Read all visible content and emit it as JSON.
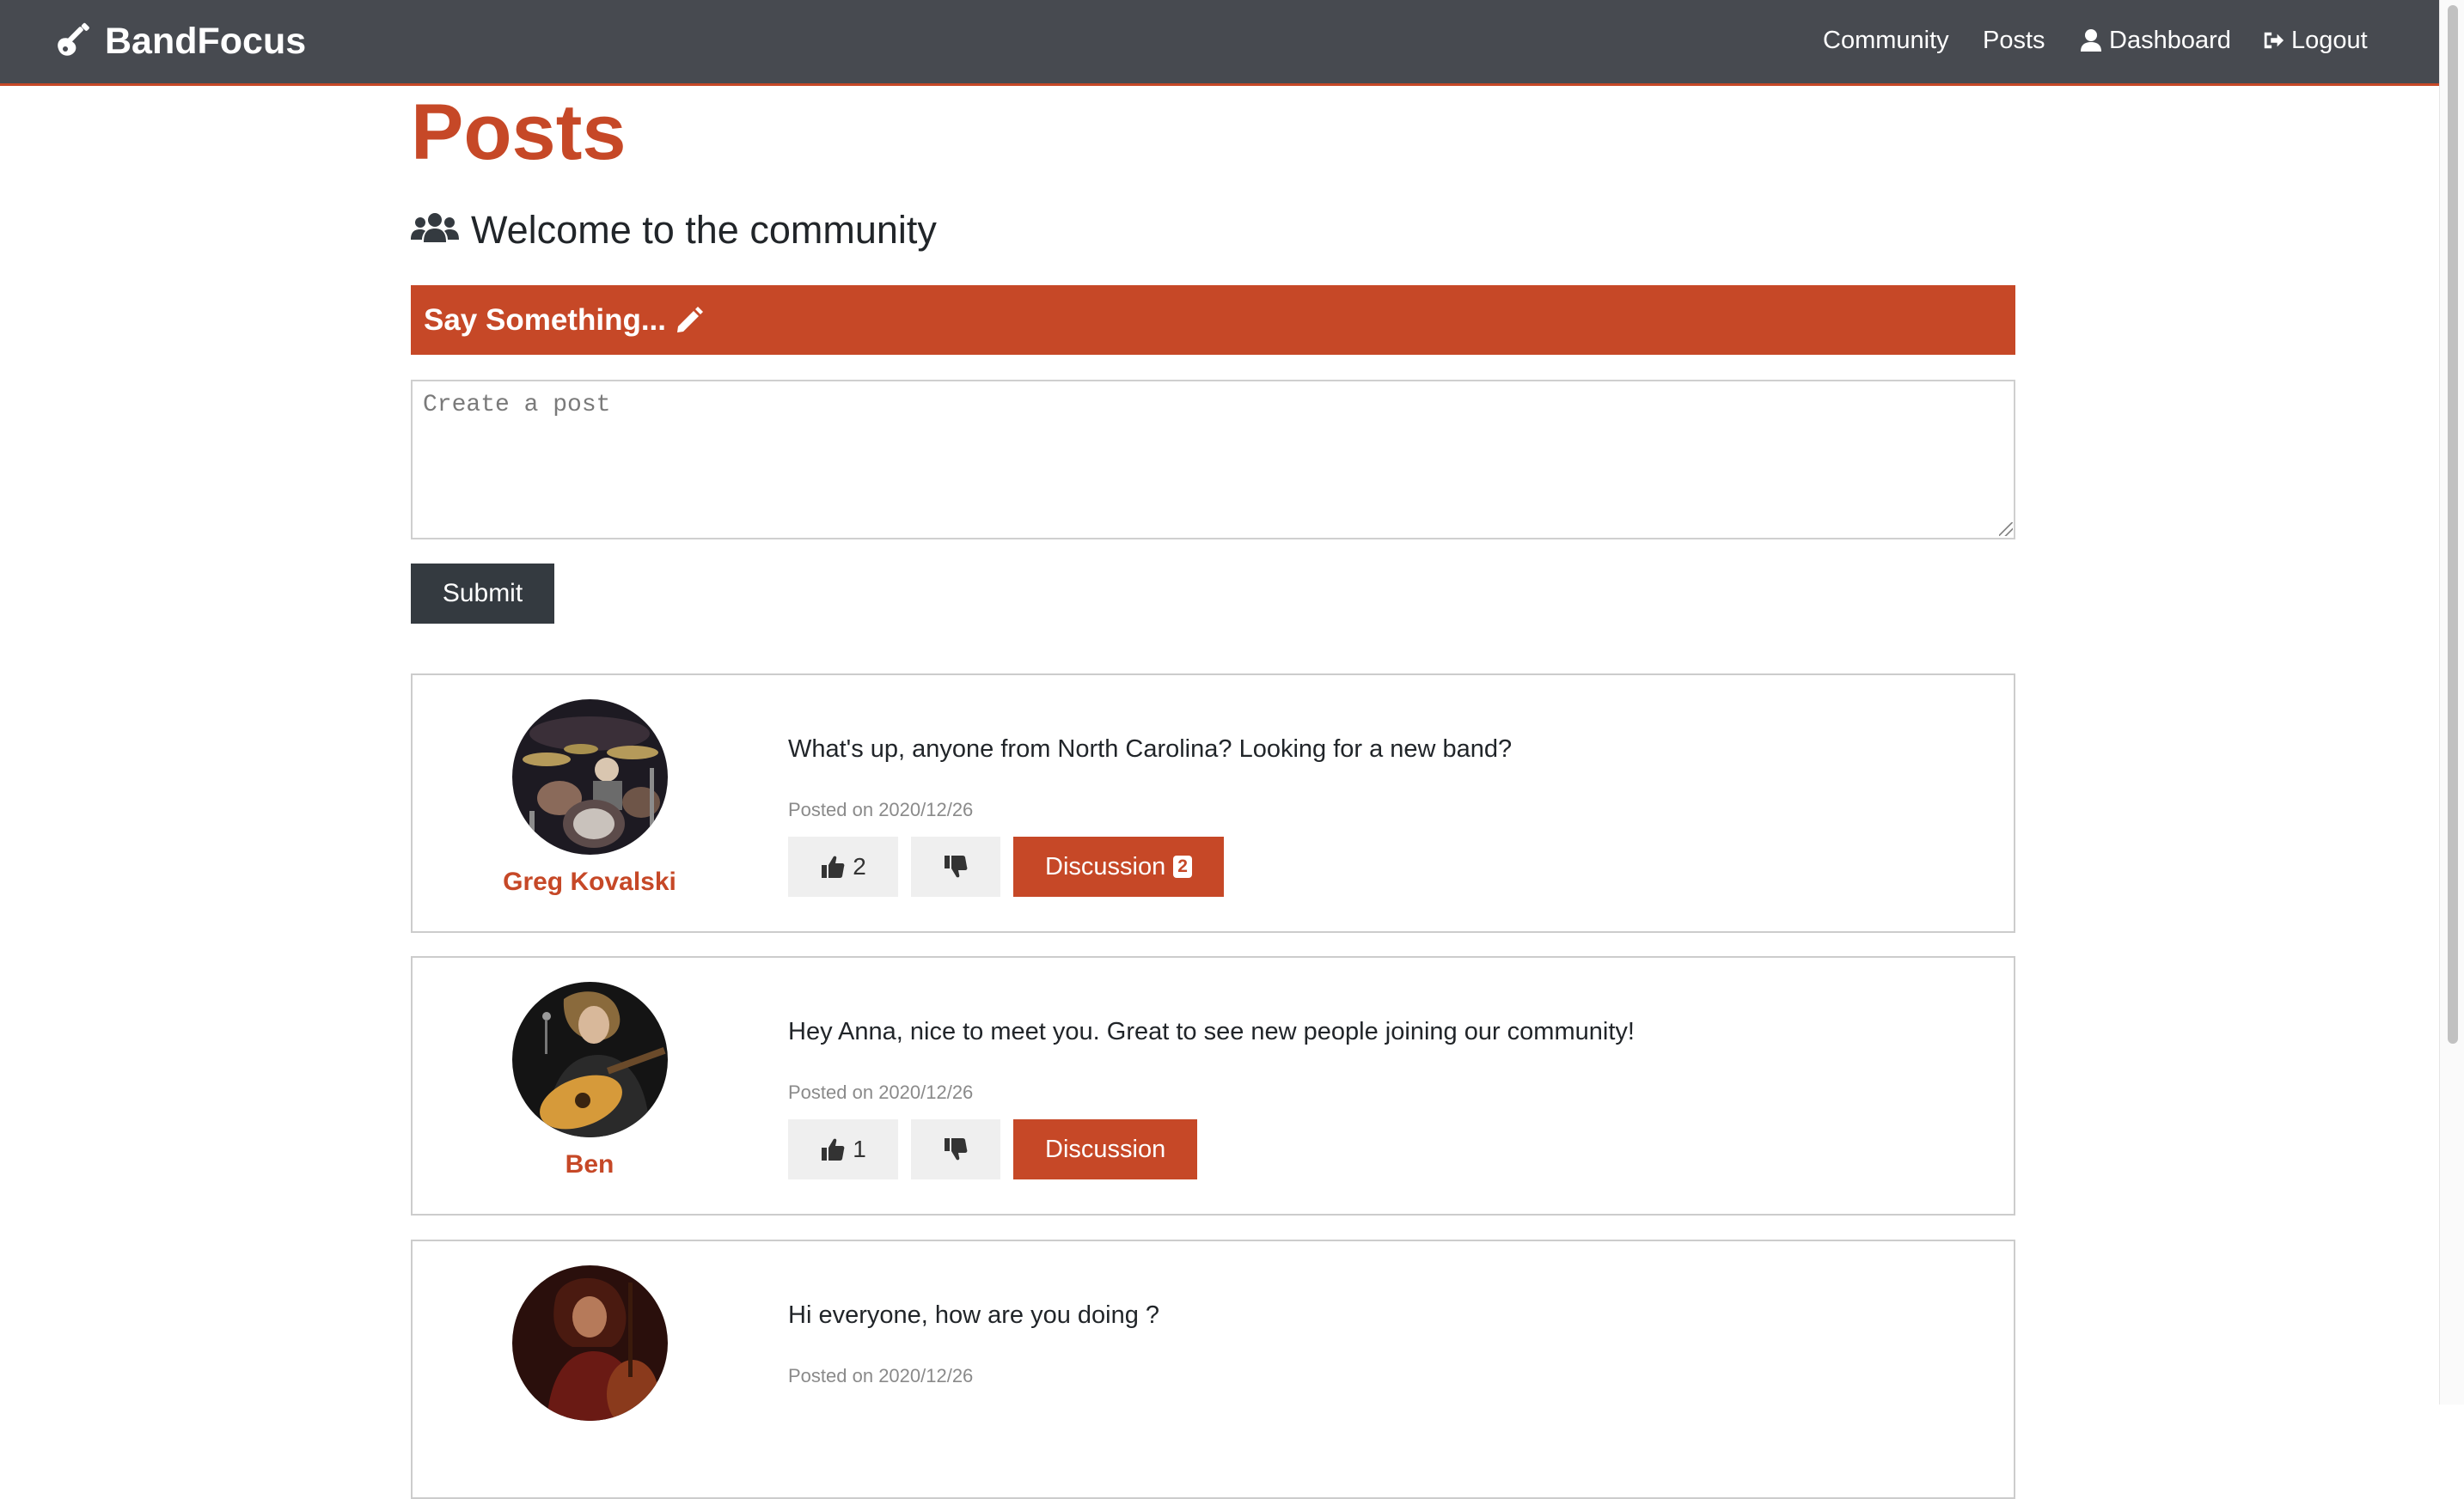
{
  "nav": {
    "brand": "BandFocus",
    "links": [
      "Community",
      "Posts",
      "Dashboard",
      "Logout"
    ]
  },
  "page": {
    "title": "Posts",
    "lead": "Welcome to the community",
    "say_something": "Say Something...",
    "input_placeholder": "Create a post",
    "submit_label": "Submit"
  },
  "posts": [
    {
      "author": "Greg Kovalski",
      "text": "What's up, anyone from North Carolina? Looking for a new band?",
      "date": "Posted on 2020/12/26",
      "likes": "2",
      "discussion_label": "Discussion",
      "comment_count": "2"
    },
    {
      "author": "Ben",
      "text": "Hey Anna, nice to meet you. Great to see new people joining our community!",
      "date": "Posted on 2020/12/26",
      "likes": "1",
      "discussion_label": "Discussion"
    },
    {
      "author": "",
      "text": "Hi everyone, how are you doing ?",
      "date": "Posted on 2020/12/26"
    }
  ],
  "colors": {
    "accent": "#c64827",
    "navbar": "#474a50",
    "dark_button": "#343a40"
  }
}
